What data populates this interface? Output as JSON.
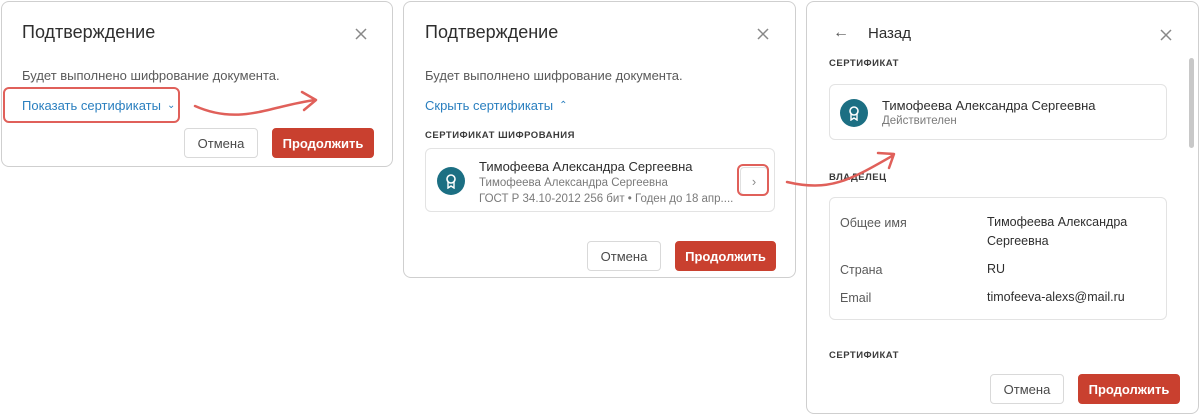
{
  "dialog1": {
    "title": "Подтверждение",
    "message": "Будет выполнено шифрование документа.",
    "show_certs_link": "Показать сертификаты",
    "cancel_label": "Отмена",
    "continue_label": "Продолжить"
  },
  "dialog2": {
    "title": "Подтверждение",
    "message": "Будет выполнено шифрование документа.",
    "hide_certs_link": "Скрыть сертификаты",
    "section_label": "СЕРТИФИКАТ ШИФРОВАНИЯ",
    "cert": {
      "name": "Тимофеева Александра Сергеевна",
      "owner": "Тимофеева Александра Сергеевна",
      "details": "ГОСТ Р 34.10-2012 256 бит • Годен до 18 апр...."
    },
    "cancel_label": "Отмена",
    "continue_label": "Продолжить"
  },
  "dialog3": {
    "back_label": "Назад",
    "section_cert_label": "СЕРТИФИКАТ",
    "cert": {
      "name": "Тимофеева Александра Сергеевна",
      "status": "Действителен"
    },
    "section_owner_label": "ВЛАДЕЛЕЦ",
    "owner_rows": [
      {
        "label": "Общее имя",
        "value_line1": "Тимофеева Александра",
        "value_line2": "Сергеевна"
      },
      {
        "label": "Страна",
        "value_line1": "RU"
      },
      {
        "label": "Email",
        "value_line1": "timofeeva-alexs@mail.ru"
      }
    ],
    "section_cert2_label": "СЕРТИФИКАТ",
    "cancel_label": "Отмена",
    "continue_label": "Продолжить"
  },
  "colors": {
    "accent_link": "#2a7fbf",
    "primary_button": "#c9402f",
    "highlight": "#e0605a",
    "cert_icon": "#1c6f83"
  }
}
